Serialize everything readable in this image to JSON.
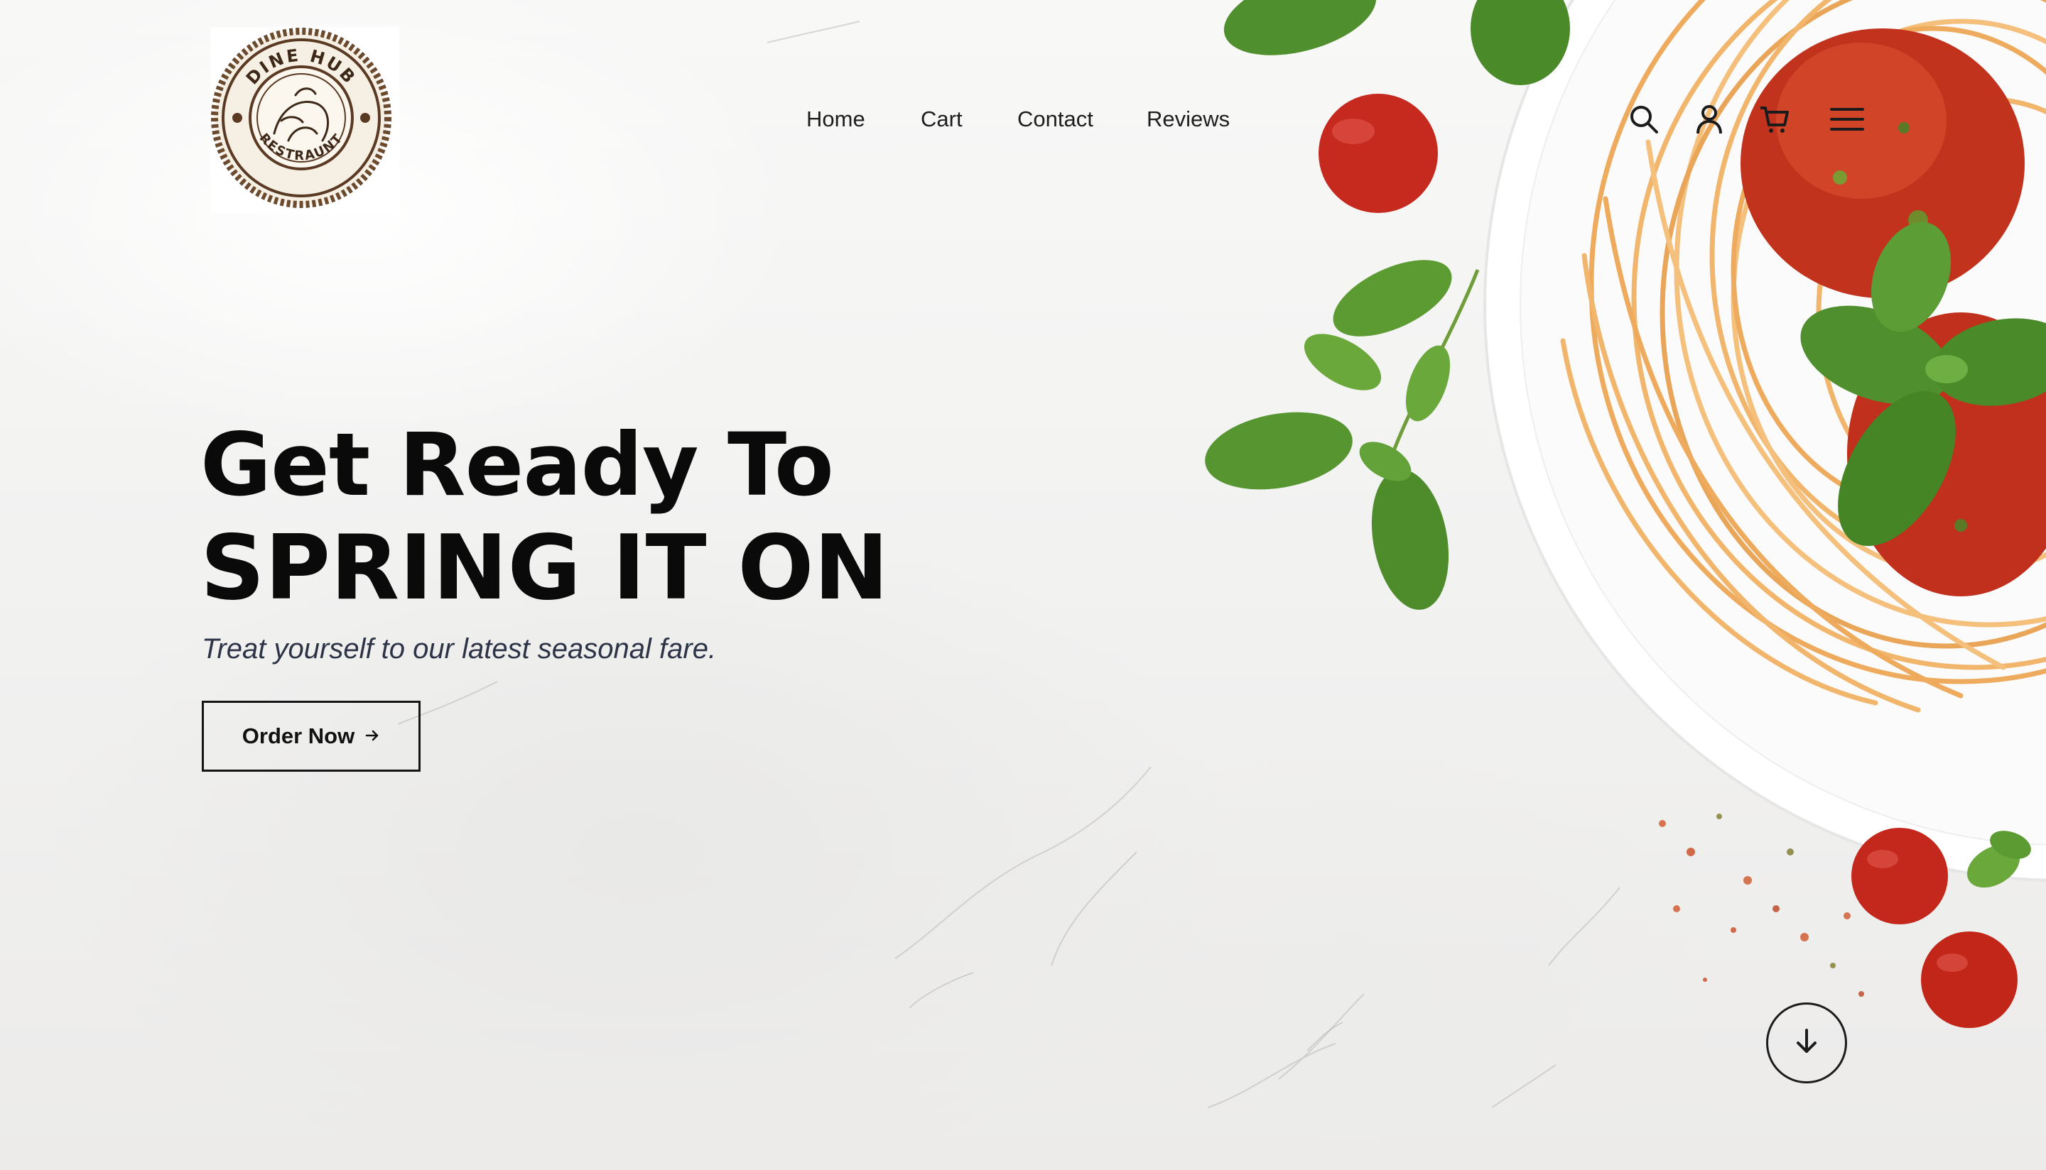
{
  "brand": {
    "name_top": "DINE HUB",
    "name_bottom": "RESTRAUNT"
  },
  "nav": {
    "items": [
      {
        "label": "Home"
      },
      {
        "label": "Cart"
      },
      {
        "label": "Contact"
      },
      {
        "label": "Reviews"
      }
    ]
  },
  "header_icons": [
    "search-icon",
    "user-icon",
    "cart-icon",
    "menu-icon"
  ],
  "hero": {
    "line1": "Get Ready To",
    "line2": "SPRING IT ON",
    "subtitle": "Treat yourself to our latest seasonal fare.",
    "cta_label": "Order Now"
  },
  "colors": {
    "text": "#0a0a0a",
    "subtitle": "#2e3447",
    "sauce": "#c0301c",
    "basil": "#4e8a2c",
    "pasta": "#f0b36a",
    "logo_brown": "#5a3a22"
  }
}
